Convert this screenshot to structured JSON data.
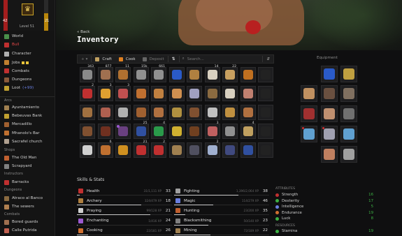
{
  "profile": {
    "hp": "42",
    "hp_max": "42",
    "xp": "21",
    "xp_fill": 0.56,
    "level": "Level 51"
  },
  "sidebar": {
    "items": [
      {
        "label": "World",
        "color": "#4a8f4a",
        "active": false
      },
      {
        "label": "Bull",
        "color": "#c03030",
        "active": true
      },
      {
        "label": "Character",
        "color": "#b0b0b0",
        "active": false
      },
      {
        "label": "Jobs",
        "color": "#c08030",
        "active": false
      },
      {
        "label": "Combats",
        "color": "#c03030",
        "active": false
      },
      {
        "label": "Dungeons",
        "color": "#8a5a3a",
        "active": false
      },
      {
        "label": "Loot",
        "color": "#c0a030",
        "active": false,
        "tag": "(+99)"
      }
    ],
    "sections": {
      "arcs": "Arcs",
      "shops": "Shops",
      "instructors": "Instructors",
      "dungeons": "Dungeons",
      "combats": "Combats"
    },
    "arcs": [
      "Ayuntamiento",
      "Bebeuvas Bank",
      "Mercadillo",
      "Mhanolo's Bar",
      "Sacrafel church"
    ],
    "shops": [
      "The Old Man",
      "Scrapyard"
    ],
    "instructors": [
      "Barracks"
    ],
    "dungeons": [
      "Atraco al Banco",
      "The sewers"
    ],
    "combats": [
      "Bored guards",
      "Calle Putrida"
    ]
  },
  "header": {
    "back": "« Back",
    "title": "Inventory"
  },
  "toolbar": {
    "add": "+",
    "craft": "Craft",
    "cook": "Cook",
    "deposit": "Deposit",
    "search_placeholder": "Search...",
    "equipment": "Equipment"
  },
  "inventory": [
    {
      "c": "#8a8a8a",
      "n": "343"
    },
    {
      "c": "#a07050",
      "n": "877"
    },
    {
      "c": "#b07030",
      "n": "11"
    },
    {
      "c": "#909090",
      "n": "15k"
    },
    {
      "c": "#909090",
      "n": "661"
    },
    {
      "c": "#2a5ac8",
      "n": ""
    },
    {
      "c": "#b08040",
      "n": ""
    },
    {
      "c": "#d8d0c0",
      "n": "14"
    },
    {
      "c": "#c8a060",
      "n": "22"
    },
    {
      "c": "#c07020",
      "n": ""
    },
    {
      "c": "#222222",
      "n": ""
    },
    {
      "c": "#c03030",
      "n": "2"
    },
    {
      "c": "#e0a030",
      "n": "3"
    },
    {
      "c": "#c05050",
      "n": "3"
    },
    {
      "c": "#c07030",
      "n": ""
    },
    {
      "c": "#c08040",
      "n": ""
    },
    {
      "c": "#d09050",
      "n": ""
    },
    {
      "c": "#a0a0c0",
      "n": ""
    },
    {
      "c": "#8a6a40",
      "n": ""
    },
    {
      "c": "#d8d0c0",
      "n": ""
    },
    {
      "c": "#c08070",
      "n": ""
    },
    {
      "c": "#222222",
      "n": ""
    },
    {
      "c": "#a07040",
      "n": ""
    },
    {
      "c": "#b06050",
      "n": ""
    },
    {
      "c": "#b0b0b0",
      "n": ""
    },
    {
      "c": "#a06030",
      "n": ""
    },
    {
      "c": "#b07040",
      "n": ""
    },
    {
      "c": "#b09040",
      "n": ""
    },
    {
      "c": "#805030",
      "n": ""
    },
    {
      "c": "#c0c0c0",
      "n": ""
    },
    {
      "c": "#c09040",
      "n": ""
    },
    {
      "c": "#b07040",
      "n": ""
    },
    {
      "c": "#222222",
      "n": ""
    },
    {
      "c": "#805030",
      "n": ""
    },
    {
      "c": "#703020",
      "n": ""
    },
    {
      "c": "#6a4080",
      "n": "",
      "dot": true
    },
    {
      "c": "#3050a0",
      "n": "25"
    },
    {
      "c": "#2a9a4a",
      "n": "4"
    },
    {
      "c": "#d0b030",
      "n": ""
    },
    {
      "c": "#704020",
      "n": ""
    },
    {
      "c": "#c06060",
      "n": "3"
    },
    {
      "c": "#909090",
      "n": ""
    },
    {
      "c": "#c0a060",
      "n": "4"
    },
    {
      "c": "#222222",
      "n": ""
    },
    {
      "c": "#d0d0d0",
      "n": ""
    },
    {
      "c": "#c07030",
      "n": "6"
    },
    {
      "c": "#d09020",
      "n": ""
    },
    {
      "c": "#c03030",
      "n": "21"
    },
    {
      "c": "#c03030",
      "n": "2"
    },
    {
      "c": "#a08050",
      "n": ""
    },
    {
      "c": "#505060",
      "n": ""
    },
    {
      "c": "#a0b0d0",
      "n": "2"
    },
    {
      "c": "#404a80",
      "n": ""
    },
    {
      "c": "#3050a0",
      "n": ""
    },
    {
      "c": "#222222",
      "n": ""
    }
  ],
  "equipment": [
    {
      "c": "#2a5ac8",
      "r": false
    },
    {
      "c": "#c0a040",
      "r": false
    },
    {
      "c": "#c09060",
      "r": false
    },
    {
      "c": "#6a5040",
      "r": false
    },
    {
      "c": "#807060",
      "r": false
    },
    {
      "c": "#a03030",
      "r": false
    },
    {
      "c": "#c09070",
      "r": false
    },
    {
      "c": "#707070",
      "r": false
    },
    {
      "c": "#60a0d0",
      "r": true
    },
    {
      "c": "#a0a0b0",
      "r": true
    },
    {
      "c": "#60a0d0",
      "r": false
    },
    {
      "c": "#c08060",
      "r": false
    },
    {
      "c": "#a0a0a0",
      "r": false
    }
  ],
  "skills": {
    "title": "Skills & Stats",
    "list": [
      {
        "name": "Health",
        "xp": "31/1,111 XP",
        "lvl": "33",
        "color": "#c03030",
        "p": 0.03
      },
      {
        "name": "Fighting",
        "xp": "1,396/2,064 XP",
        "lvl": "38",
        "color": "#a0a0a0",
        "p": 0.68
      },
      {
        "name": "Archery",
        "xp": "324/479 XP",
        "lvl": "18",
        "color": "#b08040",
        "p": 0.68
      },
      {
        "name": "Magic",
        "xp": "114/279 XP",
        "lvl": "46",
        "color": "#6a7fe0",
        "p": 0.41
      },
      {
        "name": "Praying",
        "xp": "99/128 XP",
        "lvl": "21",
        "color": "#d0d0d0",
        "p": 0.77
      },
      {
        "name": "Hunting",
        "xp": "23/200 XP",
        "lvl": "35",
        "color": "#c06030",
        "p": 0.12
      },
      {
        "name": "Enchanting",
        "xp": "1/416 XP",
        "lvl": "24",
        "color": "#9b59d0",
        "p": 0.01
      },
      {
        "name": "Blacksmithing",
        "xp": "50/140 XP",
        "lvl": "23",
        "color": "#808080",
        "p": 0.36
      },
      {
        "name": "Cooking",
        "xp": "22/181 XP",
        "lvl": "26",
        "color": "#d07030",
        "p": 0.12
      },
      {
        "name": "Mining",
        "xp": "72/189 XP",
        "lvl": "22",
        "color": "#a08050",
        "p": 0.38
      }
    ]
  },
  "attributes": {
    "title": "ATTRIBUTES",
    "list": [
      {
        "name": "Strength",
        "value": "16",
        "color": "#c03030"
      },
      {
        "name": "Dexterity",
        "value": "17",
        "color": "#3cb043"
      },
      {
        "name": "Intelligence",
        "value": "5",
        "color": "#6a7fe0"
      },
      {
        "name": "Endurance",
        "value": "19",
        "color": "#d07030"
      },
      {
        "name": "Luck",
        "value": "8",
        "color": "#3cb043"
      }
    ],
    "resources_title": "RESOURCES",
    "resources": [
      {
        "name": "Stamina",
        "value": "19",
        "color": "#3cb043"
      }
    ]
  }
}
